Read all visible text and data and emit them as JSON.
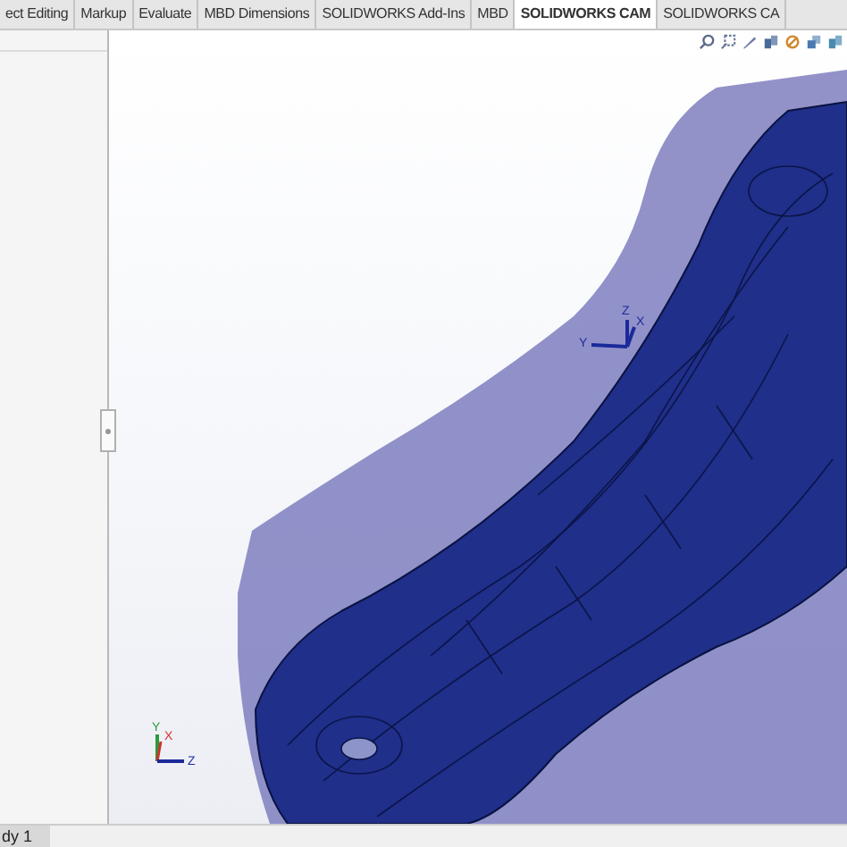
{
  "tabs": [
    {
      "label": "ect Editing",
      "selected": false
    },
    {
      "label": "Markup",
      "selected": false
    },
    {
      "label": "Evaluate",
      "selected": false
    },
    {
      "label": "MBD Dimensions",
      "selected": false
    },
    {
      "label": "SOLIDWORKS Add-Ins",
      "selected": false
    },
    {
      "label": "MBD",
      "selected": false
    },
    {
      "label": "SOLIDWORKS CAM",
      "selected": true
    },
    {
      "label": "SOLIDWORKS CA",
      "selected": false
    }
  ],
  "model_triad": {
    "y": "Y",
    "z": "Z",
    "x": "X"
  },
  "corner_triad": {
    "y": "Y",
    "x": "X",
    "z": "Z"
  },
  "bottom_tab": {
    "label": "dy 1"
  }
}
